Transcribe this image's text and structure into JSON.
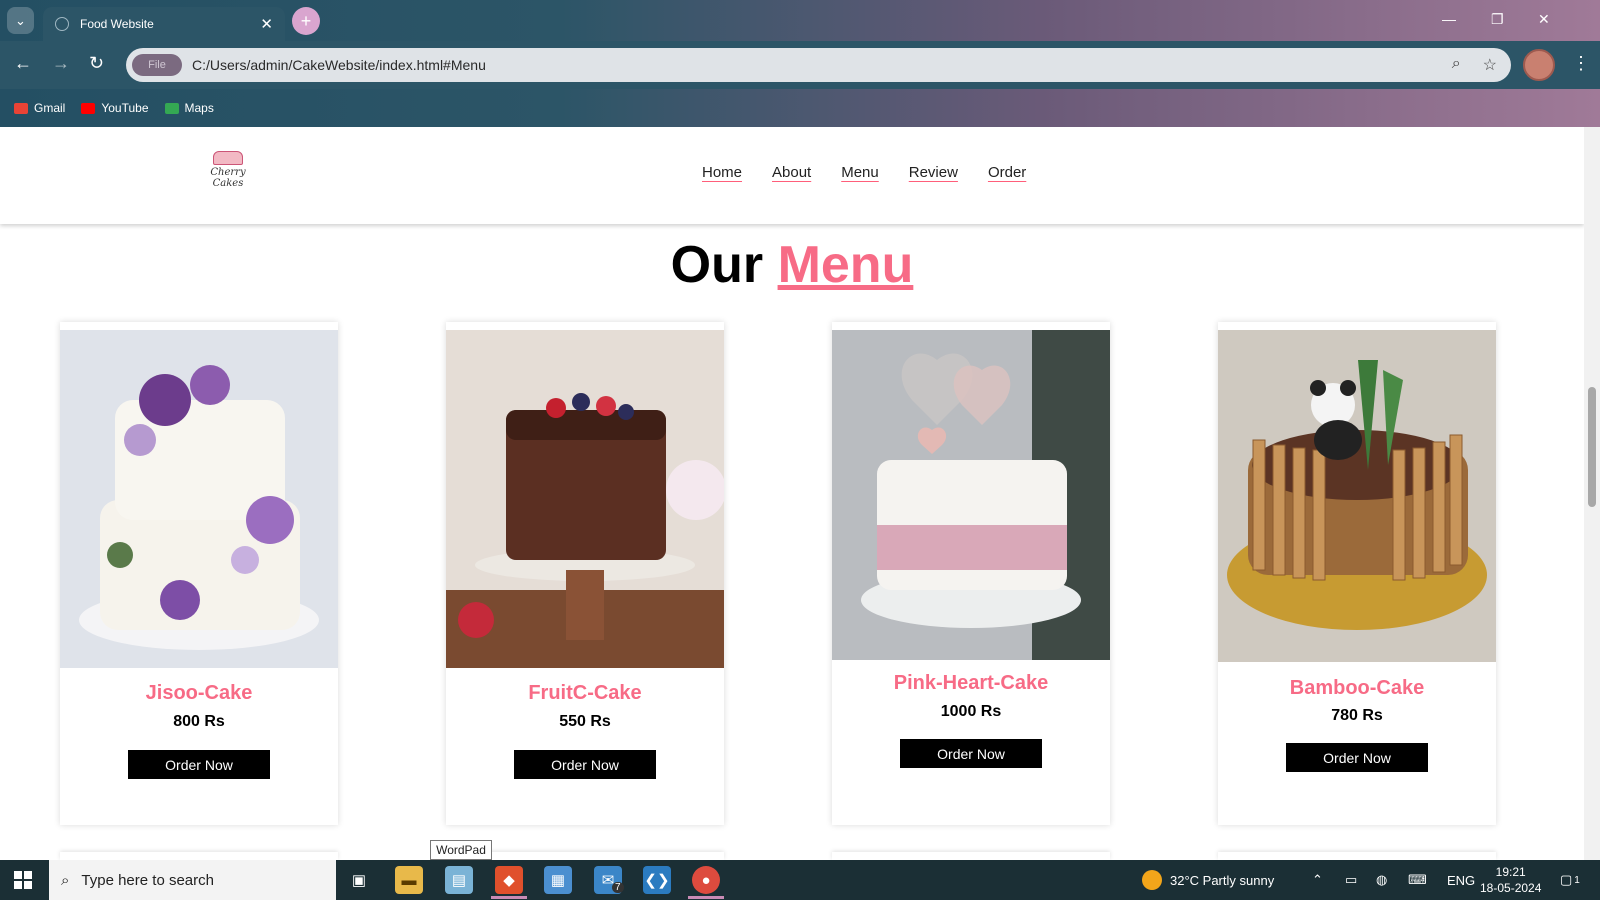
{
  "browser": {
    "tab_title": "Food Website",
    "address_chip": "File",
    "url": "C:/Users/admin/CakeWebsite/index.html#Menu",
    "bookmarks": [
      "Gmail",
      "YouTube",
      "Maps"
    ]
  },
  "site": {
    "logo_text": "Cherry Cakes",
    "nav": [
      "Home",
      "About",
      "Menu",
      "Review",
      "Order"
    ],
    "heading_prefix": "Our",
    "heading_accent": "Menu",
    "cards": [
      {
        "name": "Jisoo-Cake",
        "price": "800 Rs",
        "button": "Order Now",
        "image": "purple-flower-tiered-cake"
      },
      {
        "name": "FruitC-Cake",
        "price": "550 Rs",
        "button": "Order Now",
        "image": "chocolate-berry-drip-cake"
      },
      {
        "name": "Pink-Heart-Cake",
        "price": "1000 Rs",
        "button": "Order Now",
        "image": "white-pink-heart-topper-cake"
      },
      {
        "name": "Bamboo-Cake",
        "price": "780 Rs",
        "button": "Order Now",
        "image": "panda-bamboo-chocolate-cake"
      }
    ]
  },
  "tooltip": "WordPad",
  "taskbar": {
    "search_placeholder": "Type here to search",
    "weather": "32°C  Partly sunny",
    "language": "ENG",
    "time": "19:21",
    "date": "18-05-2024",
    "mail_badge": "7",
    "notification_badge": "1"
  },
  "colors": {
    "accent": "#f76b86",
    "browser_frame": "#2c5567",
    "button": "#000000"
  }
}
